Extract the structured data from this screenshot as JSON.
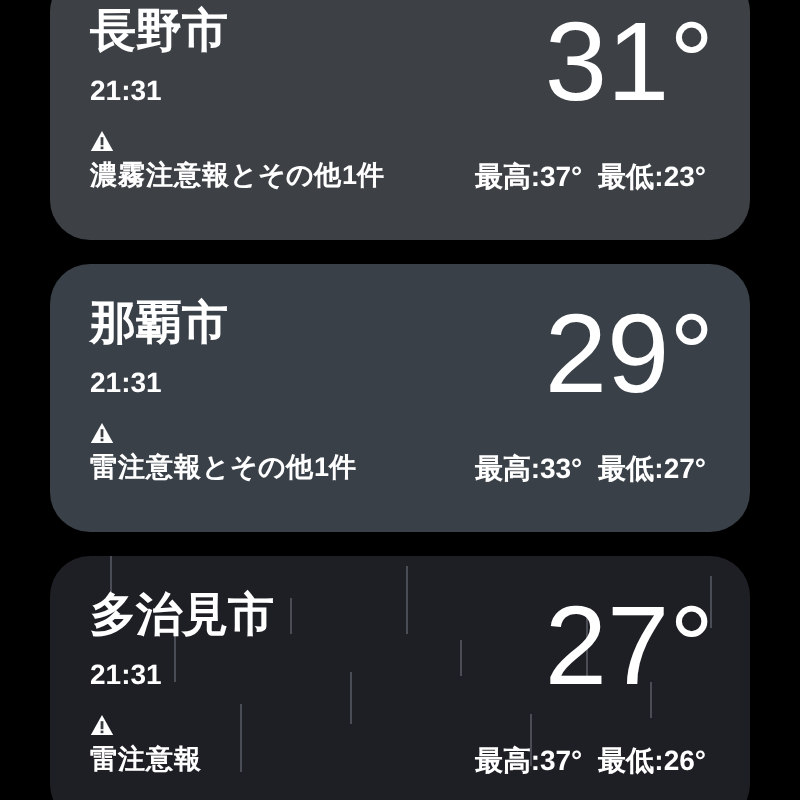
{
  "cards": [
    {
      "kind": "fog",
      "city": "長野市",
      "time": "21:31",
      "temperature": "31°",
      "alert": "濃霧注意報とその他1件",
      "high": "最高:37°",
      "low": "最低:23°"
    },
    {
      "kind": "cloudy",
      "city": "那覇市",
      "time": "21:31",
      "temperature": "29°",
      "alert": "雷注意報とその他1件",
      "high": "最高:33°",
      "low": "最低:27°"
    },
    {
      "kind": "rain",
      "city": "多治見市",
      "time": "21:31",
      "temperature": "27°",
      "alert": "雷注意報",
      "high": "最高:37°",
      "low": "最低:26°"
    }
  ]
}
